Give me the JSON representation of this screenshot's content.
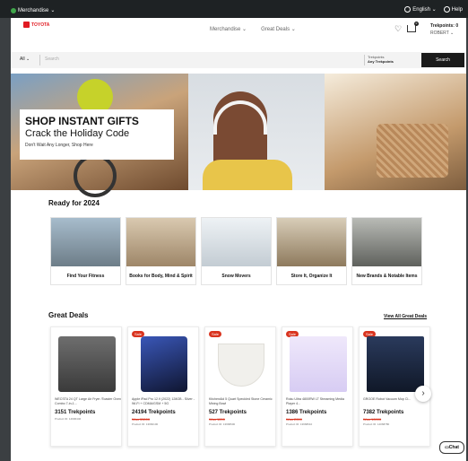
{
  "topbar": {
    "menu_label": "Merchandise",
    "language": "English",
    "help": "Help"
  },
  "header": {
    "brand": "TOYOTA",
    "nav": [
      "Merchandise",
      "Great Deals"
    ],
    "trekpoints_label": "Trekpoints: 0",
    "user": "ROBERT"
  },
  "search": {
    "scope": "All",
    "placeholder": "Search",
    "filter_label": "Trekpoints",
    "filter_value": "Any Trekpoints",
    "button": "Search"
  },
  "hero": {
    "title": "SHOP INSTANT GIFTS",
    "subtitle": "Crack the Holiday Code",
    "tagline": "Don't Wait Any Longer, Shop Here"
  },
  "ready": {
    "title": "Ready for 2024",
    "categories": [
      {
        "label": "Find Your Fitness",
        "color": "#8aa4b8"
      },
      {
        "label": "Books for Body, Mind & Spirit",
        "color": "#c9b49a"
      },
      {
        "label": "Snow Movers",
        "color": "#dfe6ec"
      },
      {
        "label": "Store It, Organize It",
        "color": "#b7a489"
      },
      {
        "label": "New Brands & Notable Items",
        "color": "#8d8f8b"
      }
    ]
  },
  "deals": {
    "title": "Great Deals",
    "view_all": "View All Great Deals",
    "sale_label": "Sale",
    "items": [
      {
        "name": "WECSTA 24 QT Large Air Fryer /Toaster Oven Combo 7-in-1...",
        "points": "3151 Trekpoints",
        "was": "",
        "pid": "Product ID: 14996446",
        "sale": false,
        "color": "#5a5a5a"
      },
      {
        "name": "Apple iPad Pro 12.9 (2022) 128GB - Silver - Wi-Fi + CDMA/GSM + 5G",
        "points": "24194 Trekpoints",
        "was": "Was 33000",
        "pid": "Product ID: 13960100",
        "sale": true,
        "color": "#1b2b5a"
      },
      {
        "name": "KitchenAid 5 Quart Speckled Stone Ceramic Mixing Bowl",
        "points": "527 Trekpoints",
        "was": "Was 1200",
        "pid": "Product ID: 13968600",
        "sale": true,
        "color": "#e9e7e2"
      },
      {
        "name": "Roku Ultra 4800RW LT Streaming Media Player 4...",
        "points": "1386 Trekpoints",
        "was": "Was 2000",
        "pid": "Product ID: 13968610",
        "sale": true,
        "color": "#6b4fc4"
      },
      {
        "name": "GROOE Robot Vacuum Mop Cl...",
        "points": "7382 Trekpoints",
        "was": "Was 10000",
        "pid": "Product ID: 14068780",
        "sale": true,
        "color": "#1f2c48"
      }
    ]
  },
  "chat_label": "Chat"
}
